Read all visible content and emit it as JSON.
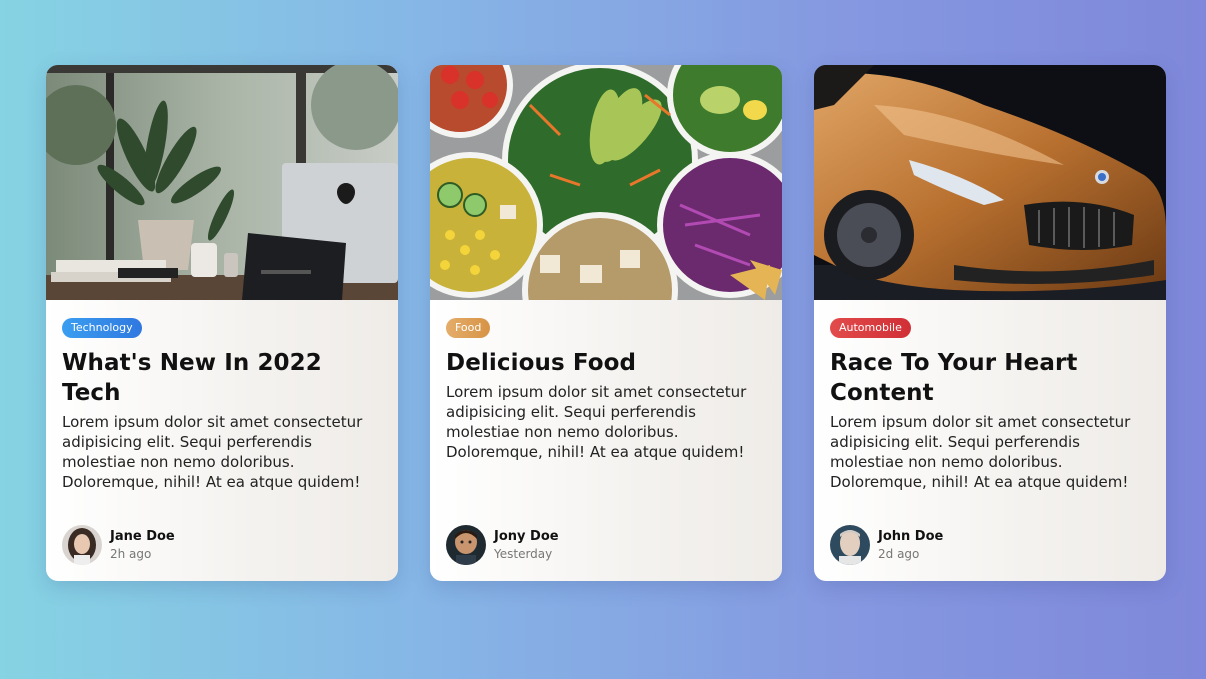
{
  "cards": [
    {
      "image": "office-desk-plants-computer",
      "tag": "Technology",
      "tag_color": "#3a9ef0",
      "title": "What's New In 2022 Tech",
      "description": "Lorem ipsum dolor sit amet consectetur adipisicing elit. Sequi perferendis molestiae non nemo doloribus. Doloremque, nihil! At ea atque quidem!",
      "author": {
        "name": "Jane Doe",
        "time": "2h ago"
      }
    },
    {
      "image": "salad-bowls",
      "tag": "Food",
      "tag_color": "#e4ad6a",
      "title": "Delicious Food",
      "description": "Lorem ipsum dolor sit amet consectetur adipisicing elit. Sequi perferendis molestiae non nemo doloribus. Doloremque, nihil! At ea atque quidem!",
      "author": {
        "name": "Jony Doe",
        "time": "Yesterday"
      }
    },
    {
      "image": "orange-sports-car",
      "tag": "Automobile",
      "tag_color": "#e24b4b",
      "title": "Race To Your Heart Content",
      "description": "Lorem ipsum dolor sit amet consectetur adipisicing elit. Sequi perferendis molestiae non nemo doloribus. Doloremque, nihil! At ea atque quidem!",
      "author": {
        "name": "John Doe",
        "time": "2d ago"
      }
    }
  ]
}
